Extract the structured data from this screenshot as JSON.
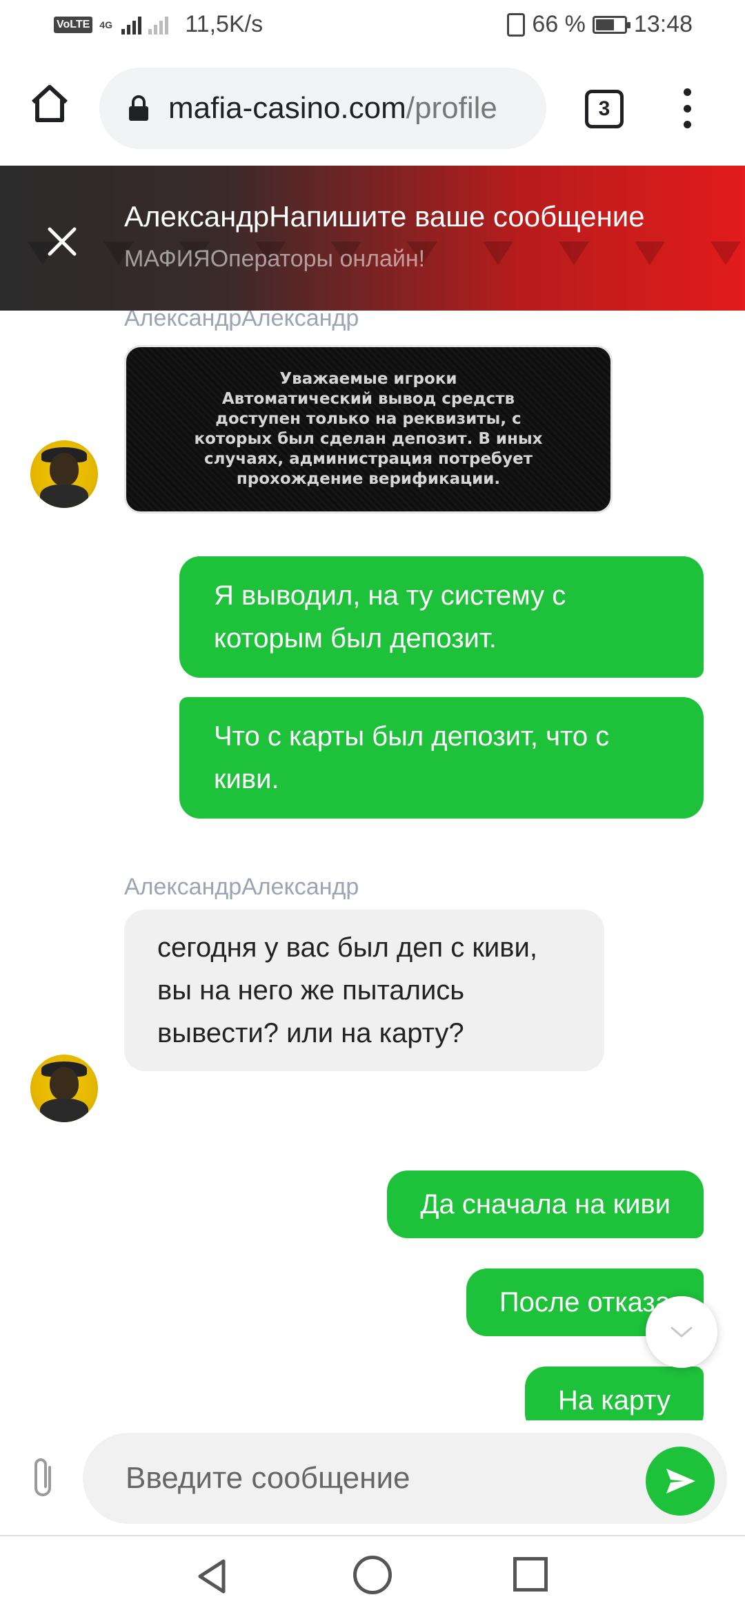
{
  "status_bar": {
    "volte": "VoLTE",
    "network": "4G",
    "speed": "11,5K/s",
    "battery": "66 %",
    "battery_level": 0.66,
    "time": "13:48"
  },
  "browser": {
    "url_main": "mafia-casino.com",
    "url_path": "/profile",
    "tab_count": "3"
  },
  "chat_header": {
    "title": "АлександрНапишите ваше сообщение",
    "subtitle": "МАФИЯОператоры онлайн!",
    "colors": {
      "dark": "#2b2b2b",
      "red": "#e21b1b"
    }
  },
  "messages": {
    "author_1": "АлександрАлександр",
    "image_text": "Уважаемые игроки\nАвтоматический вывод средств\nдоступен только на реквизиты, с\nкоторых был сделан депозит. В иных\nслучаях, администрация потребует\nпрохождение верификации.",
    "out_1": "Я выводил, на ту систему с которым был депозит.",
    "out_2": "Что с карты был депозит, что с киви.",
    "author_2": "АлександрАлександр",
    "in_1": "сегодня у вас был деп с киви, вы на него же пытались вывести? или на карту?",
    "out_3": "Да сначала на киви",
    "out_4": "После отказа",
    "out_5": "На карту"
  },
  "input": {
    "placeholder": "Введите сообщение"
  },
  "colors": {
    "accent_green": "#1dc13a",
    "incoming_bg": "#f0f0f0"
  }
}
